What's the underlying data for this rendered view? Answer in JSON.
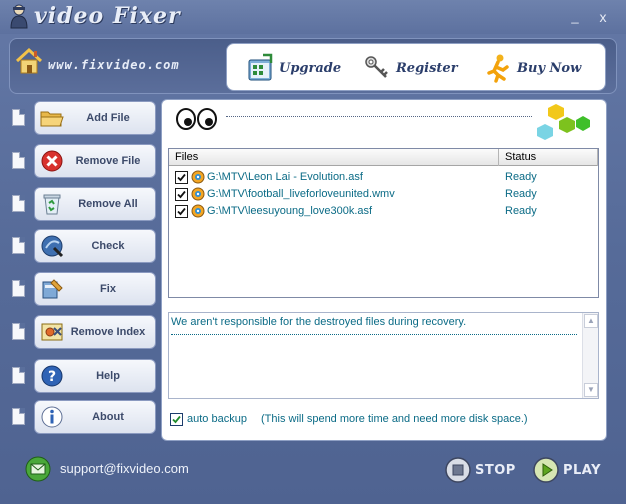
{
  "window": {
    "title": "video Fixer",
    "minimize": "_",
    "close": "x"
  },
  "header": {
    "site": "www.fixvideo.com",
    "buttons": {
      "upgrade": "Upgrade",
      "register": "Register",
      "buy_now": "Buy Now"
    }
  },
  "sidebar": {
    "items": [
      {
        "label": "Add File",
        "icon": "folder-icon"
      },
      {
        "label": "Remove File",
        "icon": "remove-icon"
      },
      {
        "label": "Remove All",
        "icon": "recycle-bin-icon"
      },
      {
        "label": "Check",
        "icon": "check-disc-icon"
      },
      {
        "label": "Fix",
        "icon": "fix-tools-icon"
      },
      {
        "label": "Remove Index",
        "icon": "remove-index-icon"
      },
      {
        "label": "Help",
        "icon": "help-icon"
      },
      {
        "label": "About",
        "icon": "info-icon"
      }
    ]
  },
  "files_table": {
    "columns": [
      "Files",
      "Status"
    ],
    "rows": [
      {
        "file": "G:\\MTV\\Leon Lai - Evolution.asf",
        "status": "Ready",
        "checked": true
      },
      {
        "file": "G:\\MTV\\football_liveforloveunited.wmv",
        "status": "Ready",
        "checked": true
      },
      {
        "file": "G:\\MTV\\leesuyoung_love300k.asf",
        "status": "Ready",
        "checked": true
      }
    ]
  },
  "log": {
    "message": "We aren't responsible for the destroyed files during recovery."
  },
  "backup": {
    "label": "auto backup",
    "note": "(This will spend more time and need more disk space.)",
    "checked": true
  },
  "footer": {
    "support": "support@fixvideo.com",
    "stop": "STOP",
    "play": "PLAY"
  },
  "colors": {
    "accent_text": "#0b6b86",
    "background": "#5a6f9c",
    "panel": "#ffffff"
  }
}
